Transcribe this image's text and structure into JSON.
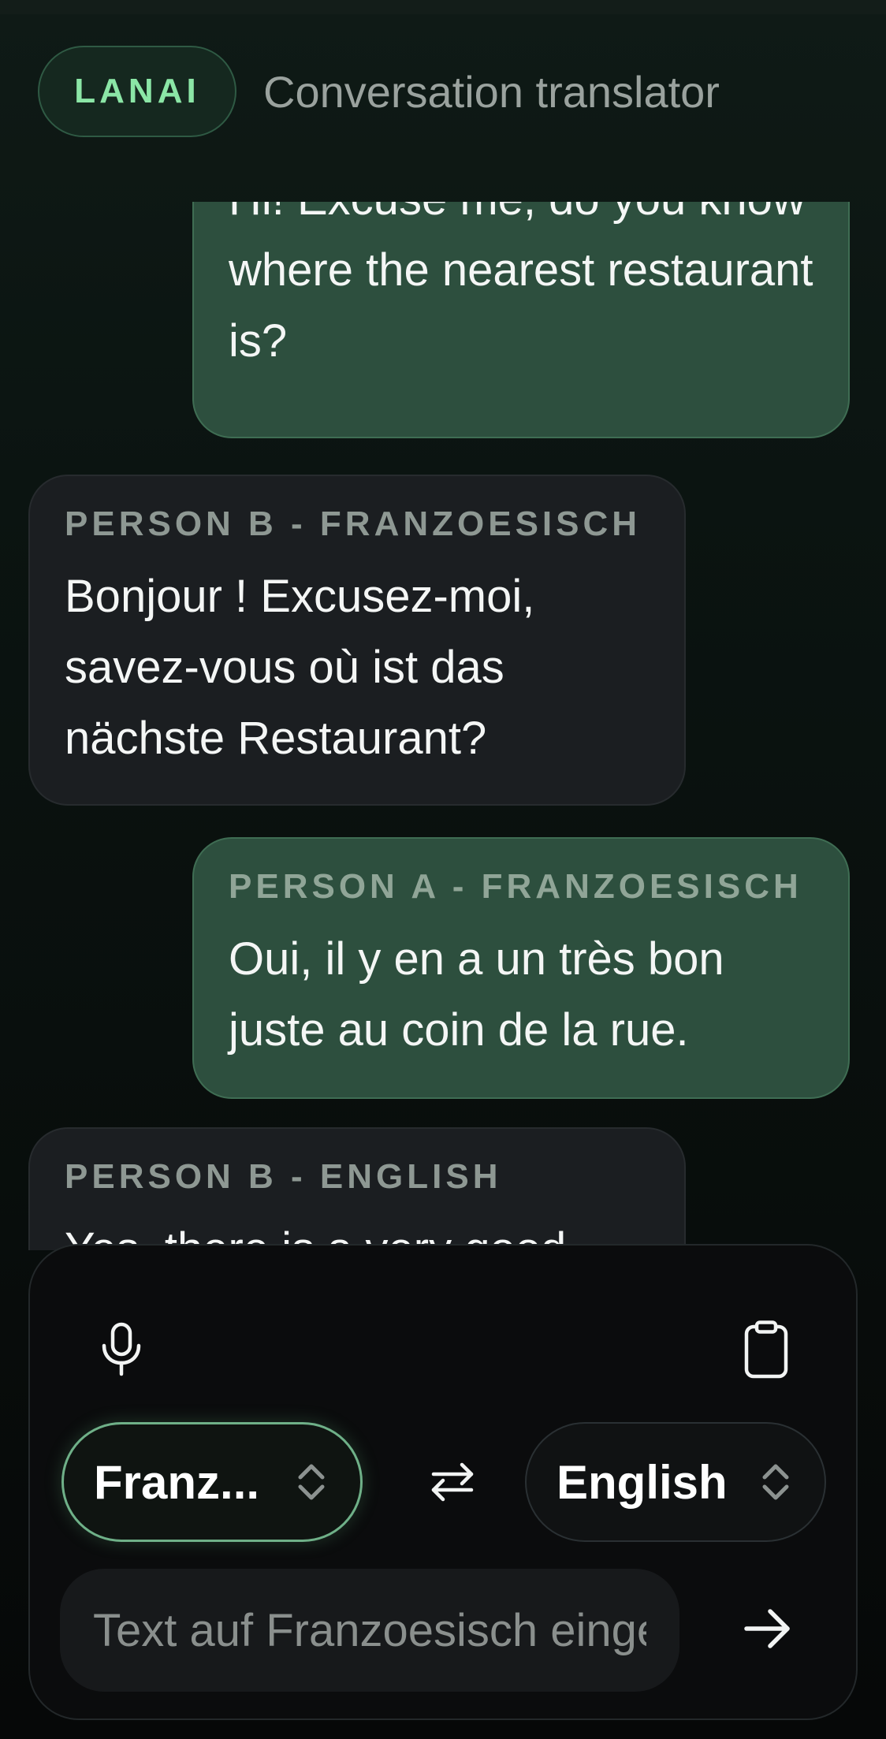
{
  "header": {
    "brand": "LANAI",
    "subtitle": "Conversation translator"
  },
  "conversation": {
    "messages": [
      {
        "side": "outgoing",
        "label": "",
        "text": "Hi! Excuse me, do you know where the nearest restaurant is?"
      },
      {
        "side": "incoming",
        "label": "PERSON B - FRANZOESISCH",
        "text": "Bonjour ! Excusez-moi, savez-vous où ist das nächste Restaurant?"
      },
      {
        "side": "outgoing",
        "label": "PERSON A - FRANZOESISCH",
        "text": "Oui, il y en a un très bon juste au coin de la rue."
      },
      {
        "side": "incoming",
        "label": "PERSON B - ENGLISH",
        "text": "Yes, there is a very good"
      }
    ]
  },
  "composer": {
    "mic_icon": "microphone-icon",
    "clipboard_icon": "clipboard-icon",
    "source_language": "Franz...",
    "target_language": "English",
    "swap_icon": "swap-arrows-icon",
    "input_value": "",
    "input_placeholder": "Text auf Franzoesisch eingeben",
    "send_icon": "arrow-right-icon"
  },
  "colors": {
    "accent": "#8be6a6",
    "outgoing_bubble": "#2d4f3e",
    "incoming_bubble": "#1b1e21",
    "background": "#0b1411"
  }
}
